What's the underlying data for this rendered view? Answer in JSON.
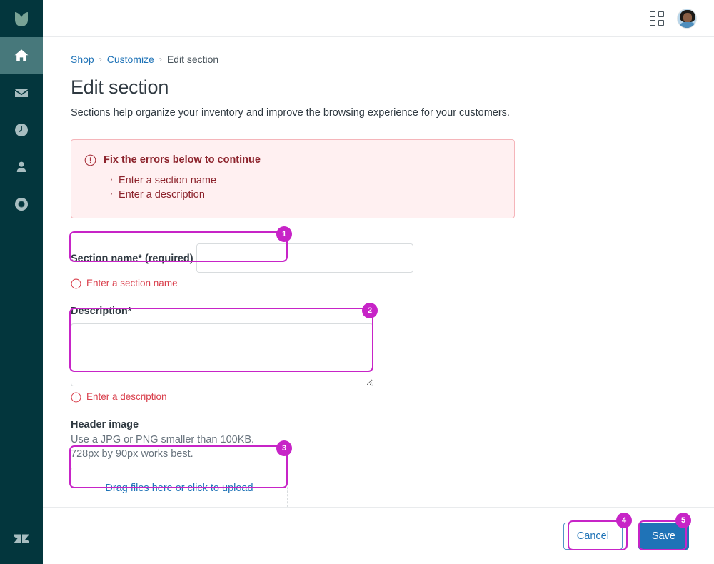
{
  "sidebar": {
    "logo_icon": "leaf-logo-icon",
    "brand_bottom_icon": "zendesk-logo-icon",
    "items": [
      {
        "icon": "home-icon",
        "name": "home",
        "active": true
      },
      {
        "icon": "mail-icon",
        "name": "mail",
        "active": false
      },
      {
        "icon": "clock-icon",
        "name": "clock",
        "active": false
      },
      {
        "icon": "user-icon",
        "name": "user",
        "active": false
      },
      {
        "icon": "lifebuoy-icon",
        "name": "support",
        "active": false
      }
    ]
  },
  "topbar": {
    "apps_icon": "apps-grid-icon",
    "avatar_icon": "user-avatar"
  },
  "breadcrumb": {
    "items": [
      {
        "label": "Shop",
        "link": true
      },
      {
        "label": "Customize",
        "link": true
      },
      {
        "label": "Edit section",
        "link": false
      }
    ],
    "separator": "›"
  },
  "page": {
    "title": "Edit section",
    "subtitle": "Sections help organize your inventory and improve the browsing experience for your customers."
  },
  "alert": {
    "icon": "alert-circle-icon",
    "title": "Fix the errors below to continue",
    "errors": [
      "Enter a section name",
      "Enter a description"
    ]
  },
  "form": {
    "section_name": {
      "label": "Section name* (required)",
      "value": "",
      "placeholder": "",
      "error": "Enter a section name",
      "error_icon": "alert-circle-icon"
    },
    "description": {
      "label": "Description*",
      "value": "",
      "placeholder": "",
      "error": "Enter a description",
      "error_icon": "alert-circle-icon"
    },
    "header_image": {
      "label": "Header image",
      "hint": "Use a JPG or PNG smaller than 100KB. 728px by 90px works best.",
      "dropzone_label": "Drag files here or click to upload"
    }
  },
  "footer": {
    "cancel_label": "Cancel",
    "save_label": "Save"
  },
  "annotations": [
    {
      "id": "1",
      "target": "section-name-input"
    },
    {
      "id": "2",
      "target": "description-textarea"
    },
    {
      "id": "3",
      "target": "header-image-dropzone"
    },
    {
      "id": "4",
      "target": "cancel-button"
    },
    {
      "id": "5",
      "target": "save-button"
    }
  ],
  "colors": {
    "sidebar_bg": "#03363d",
    "sidebar_active": "#47787b",
    "accent_blue": "#1f73b7",
    "alert_bg": "#fff0f1",
    "alert_border": "#f5b5ba",
    "alert_text": "#8c232c",
    "field_error_text": "#d93f4c",
    "annotation": "#c724c7"
  }
}
